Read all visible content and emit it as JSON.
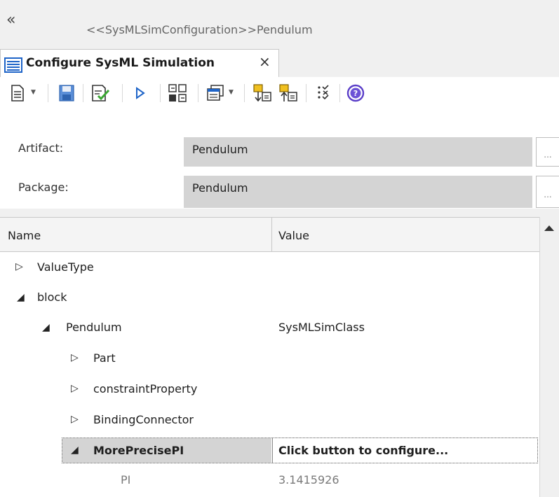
{
  "window": {
    "collapse_glyph": "«",
    "title": "<<SysMLSimConfiguration>>Pendulum"
  },
  "tab": {
    "label": "Configure SysML Simulation",
    "close_glyph": "×"
  },
  "toolbar": {
    "items": [
      {
        "icon": "new-document-icon",
        "has_dropdown": true
      },
      {
        "icon": "save-icon"
      },
      {
        "icon": "validate-icon"
      },
      {
        "icon": "run-simulation-icon"
      },
      {
        "icon": "export-model-icon"
      },
      {
        "icon": "window-options-icon",
        "has_dropdown": true
      },
      {
        "icon": "move-down-icon"
      },
      {
        "icon": "move-up-icon"
      },
      {
        "icon": "checklist-icon"
      },
      {
        "icon": "help-icon"
      }
    ],
    "dropdown_glyph": "▼"
  },
  "form": {
    "artifact_label": "Artifact:",
    "artifact_value": "Pendulum",
    "package_label": "Package:",
    "package_value": "Pendulum",
    "browse_glyph": "..."
  },
  "grid": {
    "col_name": "Name",
    "col_value": "Value",
    "rows": [
      {
        "name": "ValueType",
        "value": "",
        "expander": "▷"
      },
      {
        "name": "block",
        "value": "",
        "expander": "◢"
      },
      {
        "name": "Pendulum",
        "value": "SysMLSimClass",
        "expander": "◢"
      },
      {
        "name": "Part",
        "value": "",
        "expander": "▷"
      },
      {
        "name": "constraintProperty",
        "value": "",
        "expander": "▷"
      },
      {
        "name": "BindingConnector",
        "value": "",
        "expander": "▷"
      },
      {
        "name": "MorePrecisePI",
        "value": "Click button to configure...",
        "expander": "◢",
        "selected": true
      },
      {
        "name": "PI",
        "value": "3.1415926",
        "expander": ""
      }
    ]
  },
  "colors": {
    "accent": "#1e64c8",
    "selected_bg": "#d4d4d4",
    "field_bg": "#d4d4d4"
  }
}
